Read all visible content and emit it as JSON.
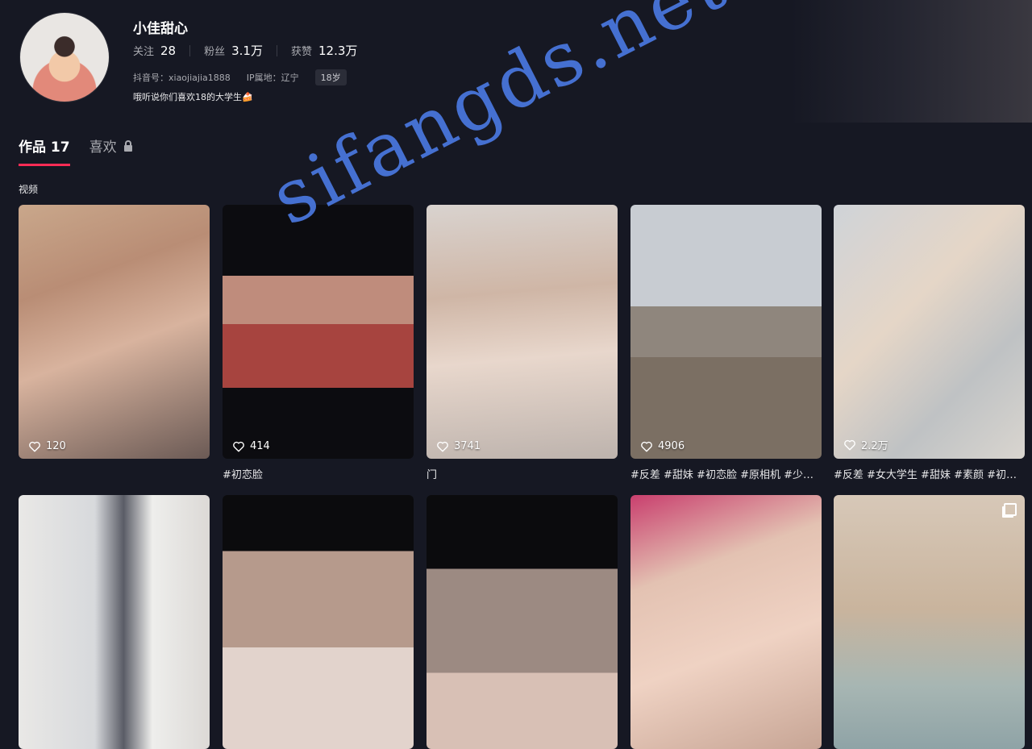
{
  "profile": {
    "name": "小佳甜心",
    "stats": [
      {
        "label": "关注",
        "value": "28"
      },
      {
        "label": "粉丝",
        "value": "3.1万"
      },
      {
        "label": "获赞",
        "value": "12.3万"
      }
    ],
    "douyin_id": "抖音号：xiaojiajia1888",
    "ip_location": "IP属地：辽宁",
    "age_badge": "18岁",
    "bio": "哦听说你们喜欢18的大学生🍰"
  },
  "tabs": [
    {
      "label": "作品 17"
    },
    {
      "label": "喜欢"
    }
  ],
  "section_label": "视频",
  "videos": [
    {
      "likes": "120",
      "caption": ""
    },
    {
      "likes": "414",
      "caption": "#初恋脸"
    },
    {
      "likes": "3741",
      "caption": "门"
    },
    {
      "likes": "4906",
      "caption": "#反差 #甜妹 #初恋脸 #原相机 #少…"
    },
    {
      "likes": "2.2万",
      "caption": "#反差 #女大学生 #甜妹 #素颜 #初…"
    },
    {
      "likes": "",
      "caption": ""
    },
    {
      "likes": "",
      "caption": ""
    },
    {
      "likes": "",
      "caption": ""
    },
    {
      "likes": "",
      "caption": ""
    },
    {
      "likes": "",
      "caption": ""
    }
  ],
  "watermark": "sifangds.net",
  "colors": {
    "background": "#161823",
    "accent": "#fe2c55",
    "watermark": "#4a78e0"
  }
}
